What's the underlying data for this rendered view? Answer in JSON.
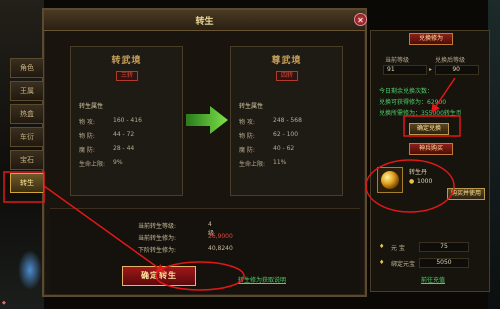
{
  "window": {
    "title": "转生",
    "close": "✕"
  },
  "tabs": [
    "角色",
    "王属",
    "热盒",
    "车衍",
    "宝石",
    "转生"
  ],
  "left_box": {
    "header": "转武境",
    "badge": "三转",
    "section": "转生属性",
    "rows": [
      {
        "label": "物  攻:",
        "value": "160 - 416"
      },
      {
        "label": "物  防:",
        "value": "44 - 72"
      },
      {
        "label": "魔  防:",
        "value": "28 - 44"
      },
      {
        "label": "生命上限:",
        "value": "9%"
      }
    ]
  },
  "right_box": {
    "header": "尊武境",
    "badge": "四转",
    "section": "转生属性",
    "rows": [
      {
        "label": "物  攻:",
        "value": "248 - 568"
      },
      {
        "label": "物  防:",
        "value": "62 - 100"
      },
      {
        "label": "魔  防:",
        "value": "40 - 62"
      },
      {
        "label": "生命上限:",
        "value": "11%"
      }
    ]
  },
  "bottom": {
    "level_label": "当前转生等级:",
    "level_value": "4 级",
    "cultivation_label": "当前转生修为:",
    "cultivation_value": "26,9000",
    "next_label": "下阶转生修为:",
    "next_value": "40,8240",
    "confirm": "确定转生",
    "link": "转生修为获取说明"
  },
  "side": {
    "exchange_header": "兑换修为",
    "current_level_label": "当前等级",
    "current_level": "91",
    "after_level_label": "兑换后等级",
    "after_level": "90",
    "info_line1": "今日剩余兑换次数：",
    "info_line2": "兑换可获得修为：62900",
    "info_line3": "兑换所需修为：355000转生币",
    "exchange_button": "确定兑换",
    "shop_header": "神兵购买",
    "item_name": "转生丹",
    "item_price": "1000",
    "buy_button": "购买并使用",
    "gold_label": "元  宝",
    "gold_value": "75",
    "bound_label": "绑定元宝",
    "bound_value": "5050",
    "recharge": "前往充值"
  },
  "colors": {
    "accent_red": "#e04a3a",
    "green": "#4fd06a",
    "gold": "#e9d59a"
  }
}
